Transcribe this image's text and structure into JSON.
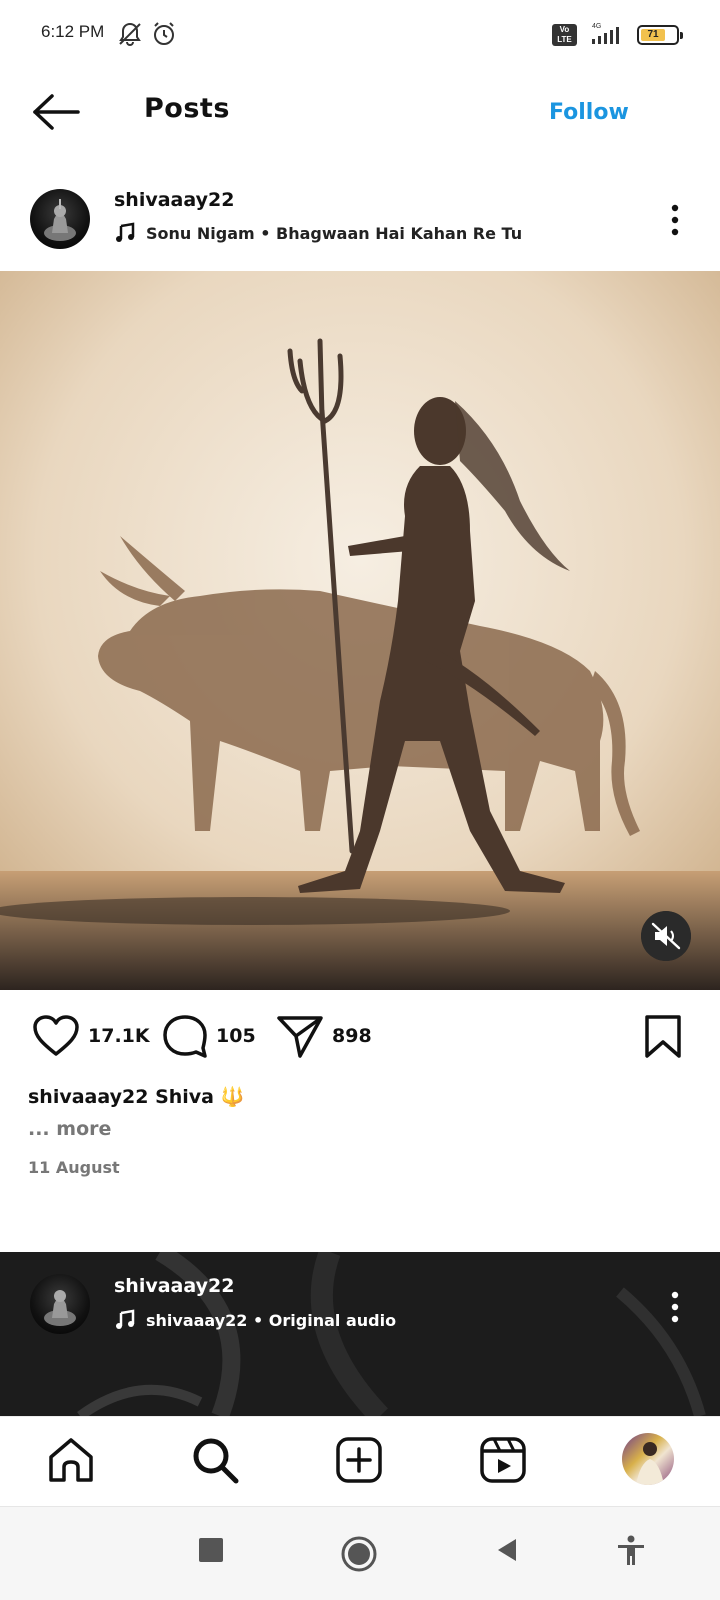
{
  "status_bar": {
    "time": "6:12 PM",
    "network_label": "Vo LTE",
    "network_type": "4G",
    "battery_level": "71"
  },
  "header": {
    "title": "Posts",
    "follow_label": "Follow"
  },
  "post": {
    "username": "shivaaay22",
    "audio": "Sonu Nigam • Bhagwaan Hai Kahan Re Tu",
    "likes": "17.1K",
    "comments": "105",
    "shares": "898",
    "caption_username": "shivaaay22",
    "caption_text": "Shiva 🔱",
    "more_label": "... more",
    "date": "11 August"
  },
  "next_post": {
    "username": "shivaaay22",
    "audio": "shivaaay22 • Original audio"
  },
  "icons": {
    "back": "arrow-left-icon",
    "more": "three-dots-vertical-icon",
    "music": "music-note-icon",
    "mute": "speaker-muted-icon",
    "like": "heart-icon",
    "comment": "speech-bubble-icon",
    "share": "paper-plane-icon",
    "save": "bookmark-icon",
    "nav_home": "home-icon",
    "nav_search": "search-icon",
    "nav_create": "plus-square-icon",
    "nav_reels": "reels-icon"
  },
  "colors": {
    "follow": "#1b95e0",
    "battery": "#f2c14e"
  }
}
